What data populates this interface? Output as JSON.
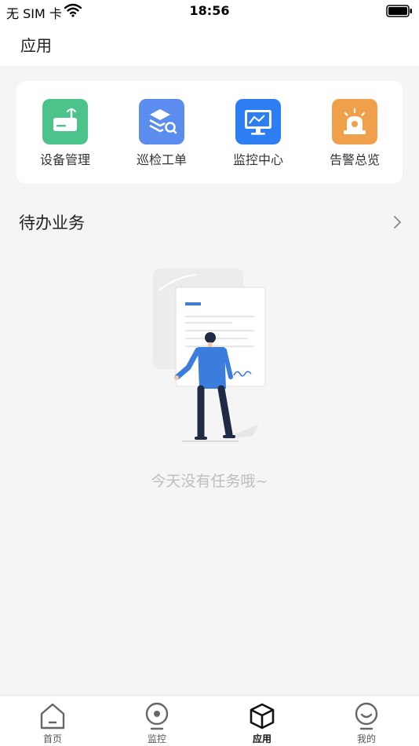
{
  "status_bar": {
    "carrier": "无 SIM 卡",
    "time": "18:56"
  },
  "header": {
    "title": "应用"
  },
  "apps": [
    {
      "label": "设备管理",
      "icon": "router-icon",
      "color": "#4cc38a"
    },
    {
      "label": "巡检工单",
      "icon": "layers-search-icon",
      "color": "#5b8def"
    },
    {
      "label": "监控中心",
      "icon": "monitor-icon",
      "color": "#2d7ef2"
    },
    {
      "label": "告警总览",
      "icon": "alarm-light-icon",
      "color": "#f0a04b"
    }
  ],
  "todo": {
    "title": "待办业务",
    "empty_text": "今天没有任务哦~"
  },
  "tabs": [
    {
      "label": "首页",
      "icon": "home-icon",
      "active": false
    },
    {
      "label": "监控",
      "icon": "camera-icon",
      "active": false
    },
    {
      "label": "应用",
      "icon": "cube-icon",
      "active": true
    },
    {
      "label": "我的",
      "icon": "profile-icon",
      "active": false
    }
  ]
}
